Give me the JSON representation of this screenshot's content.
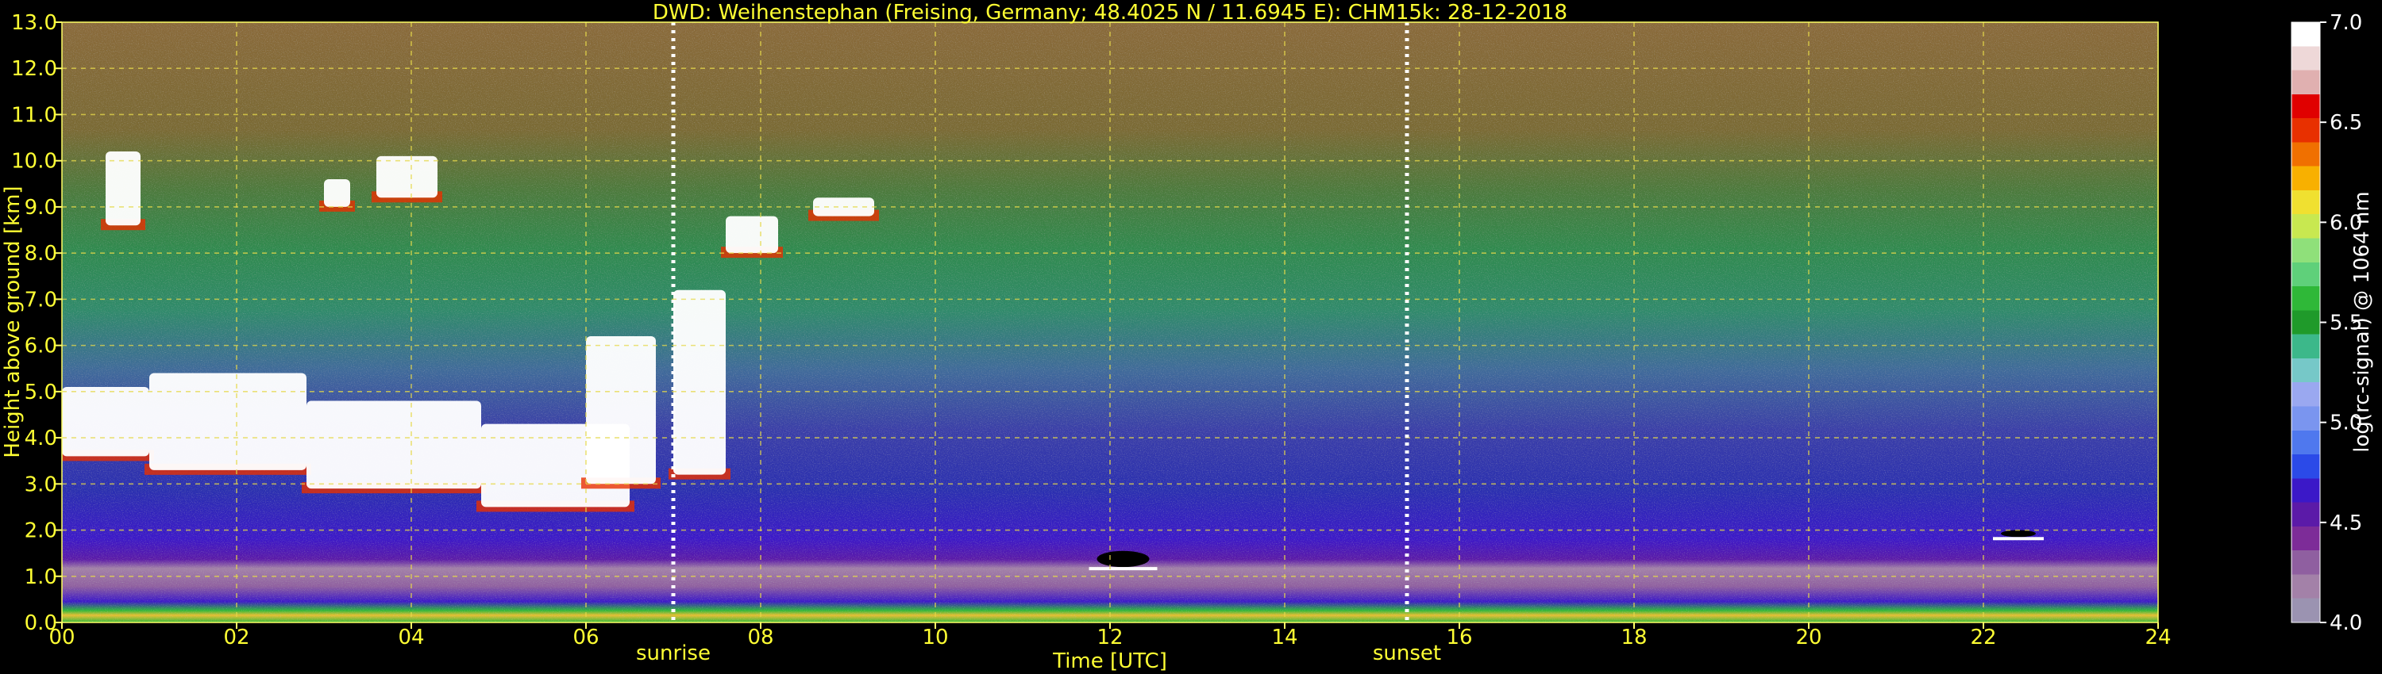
{
  "chart_data": {
    "type": "heatmap",
    "title": "DWD: Weihenstephan (Freising, Germany; 48.4025 N / 11.6945 E):    CHM15k: 28-12-2018",
    "xlabel": "Time [UTC]",
    "ylabel": "Height above ground [km]",
    "colorbar_label": "log(rc-signal) @ 1064 nm",
    "xlim": [
      0,
      24
    ],
    "ylim": [
      0,
      13
    ],
    "clim": [
      4.0,
      7.0
    ],
    "x_ticks": [
      0,
      2,
      4,
      6,
      8,
      10,
      12,
      14,
      16,
      18,
      20,
      22,
      24
    ],
    "x_tick_labels": [
      "00",
      "02",
      "04",
      "06",
      "08",
      "10",
      "12",
      "14",
      "16",
      "18",
      "20",
      "22",
      "24"
    ],
    "y_ticks": [
      0,
      1,
      2,
      3,
      4,
      5,
      6,
      7,
      8,
      9,
      10,
      11,
      12,
      13
    ],
    "y_tick_labels": [
      "0.0",
      "1.0",
      "2.0",
      "3.0",
      "4.0",
      "5.0",
      "6.0",
      "7.0",
      "8.0",
      "9.0",
      "10.0",
      "11.0",
      "12.0",
      "13.0"
    ],
    "cbar_ticks": [
      4.0,
      4.5,
      5.0,
      5.5,
      6.0,
      6.5,
      7.0
    ],
    "cbar_tick_labels": [
      "4.0",
      "4.5",
      "5.0",
      "5.5",
      "6.0",
      "6.5",
      "7.0"
    ],
    "grid": true,
    "markers": [
      {
        "label": "sunrise",
        "x": 7.0
      },
      {
        "label": "sunset",
        "x": 15.4
      }
    ],
    "colormap": [
      "#9b93b1",
      "#a381a8",
      "#8f5fa0",
      "#7d2c98",
      "#5b1aa8",
      "#3b18c8",
      "#2b4ae8",
      "#4f78ee",
      "#7a95ef",
      "#9aa8f0",
      "#76c8c8",
      "#3cb88a",
      "#1f9a2a",
      "#2fb838",
      "#5fd07a",
      "#8fe07a",
      "#c8e850",
      "#f0e030",
      "#f8b000",
      "#f07000",
      "#e83000",
      "#e00000",
      "#e0b0b0",
      "#eed8d8",
      "#ffffff"
    ],
    "features": [
      {
        "kind": "cloud",
        "x0": 0.0,
        "x1": 1.0,
        "y0": 3.6,
        "y1": 5.1
      },
      {
        "kind": "cloud",
        "x0": 1.0,
        "x1": 2.8,
        "y0": 3.3,
        "y1": 5.4
      },
      {
        "kind": "cloud",
        "x0": 2.8,
        "x1": 4.8,
        "y0": 2.9,
        "y1": 4.8
      },
      {
        "kind": "cloud",
        "x0": 4.8,
        "x1": 6.5,
        "y0": 2.5,
        "y1": 4.3
      },
      {
        "kind": "cloud",
        "x0": 6.0,
        "x1": 6.8,
        "y0": 3.0,
        "y1": 6.2
      },
      {
        "kind": "cloud",
        "x0": 7.0,
        "x1": 7.6,
        "y0": 3.2,
        "y1": 7.2
      },
      {
        "kind": "cloud",
        "x0": 0.5,
        "x1": 0.9,
        "y0": 8.6,
        "y1": 10.2
      },
      {
        "kind": "cloud",
        "x0": 3.0,
        "x1": 3.3,
        "y0": 9.0,
        "y1": 9.6
      },
      {
        "kind": "cloud",
        "x0": 3.6,
        "x1": 4.3,
        "y0": 9.2,
        "y1": 10.1
      },
      {
        "kind": "cloud",
        "x0": 7.6,
        "x1": 8.2,
        "y0": 8.0,
        "y1": 8.8
      },
      {
        "kind": "cloud",
        "x0": 8.6,
        "x1": 9.3,
        "y0": 8.8,
        "y1": 9.2
      },
      {
        "kind": "dark",
        "x0": 11.85,
        "x1": 12.45,
        "y0": 1.2,
        "y1": 1.55
      },
      {
        "kind": "dark",
        "x0": 22.2,
        "x1": 22.6,
        "y0": 1.85,
        "y1": 2.0
      }
    ]
  }
}
